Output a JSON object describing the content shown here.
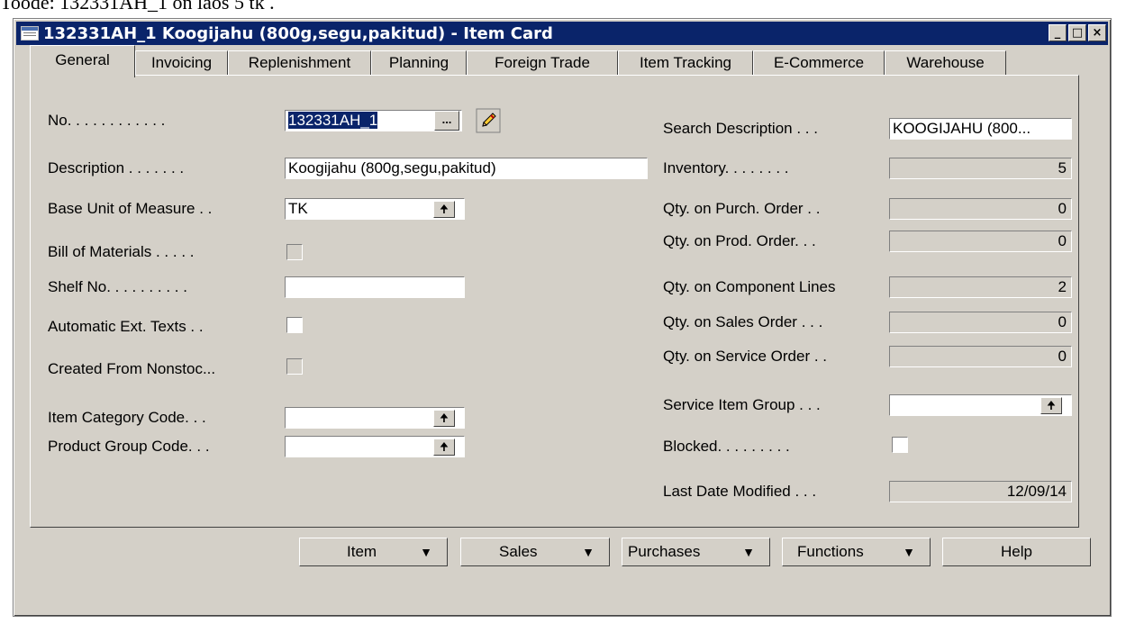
{
  "caption": "Toode: 132331AH_1 on laos 5 tk .",
  "window": {
    "title": "132331AH_1 Koogijahu (800g,segu,pakitud) - Item Card",
    "controls": [
      "_",
      "□",
      "×"
    ]
  },
  "tabs": [
    "General",
    "Invoicing",
    "Replenishment",
    "Planning",
    "Foreign Trade",
    "Item Tracking",
    "E-Commerce",
    "Warehouse"
  ],
  "left": {
    "no_label": "No. . . . . . . . . . . .",
    "no_value": "132331AH_1",
    "no_lookup": "...",
    "description_label": "Description . . . . . . .",
    "description_value": "Koogijahu (800g,segu,pakitud)",
    "base_uom_label": "Base Unit of Measure . .",
    "base_uom_value": "TK",
    "bom_label": "Bill of Materials . . . . .",
    "shelf_label": "Shelf No. . . . . . . . . .",
    "shelf_value": "",
    "auto_ext_label": "Automatic Ext. Texts . .",
    "created_nonstock_label": "Created From Nonstoc...",
    "item_category_label": "Item Category Code. . .",
    "item_category_value": "",
    "product_group_label": "Product Group Code. . .",
    "product_group_value": ""
  },
  "right": {
    "search_desc_label": "Search Description . . .",
    "search_desc_value": "KOOGIJAHU (800...",
    "inventory_label": "Inventory. . . . . . . .",
    "inventory_value": "5",
    "purch_label": "Qty. on Purch. Order . .",
    "purch_value": "0",
    "prod_label": "Qty. on Prod. Order. . .",
    "prod_value": "0",
    "comp_label": "Qty. on Component Lines",
    "comp_value": "2",
    "sales_label": "Qty. on Sales Order . . .",
    "sales_value": "0",
    "service_label": "Qty. on Service Order . .",
    "service_value": "0",
    "service_group_label": "Service Item Group . . .",
    "service_group_value": "",
    "blocked_label": "Blocked. . . . . . . . .",
    "last_modified_label": "Last Date Modified . . .",
    "last_modified_value": "12/09/14"
  },
  "buttons": {
    "item": "Item",
    "sales": "Sales",
    "purchases": "Purchases",
    "functions": "Functions",
    "help": "Help"
  },
  "colors": {
    "titlebar": "#0a246a",
    "face": "#d4d0c8",
    "selection": "#0a246a"
  },
  "icons": [
    "item-card-icon",
    "edit-pencil-icon",
    "lookup-arrow-icon",
    "dropdown-arrow-icon"
  ]
}
